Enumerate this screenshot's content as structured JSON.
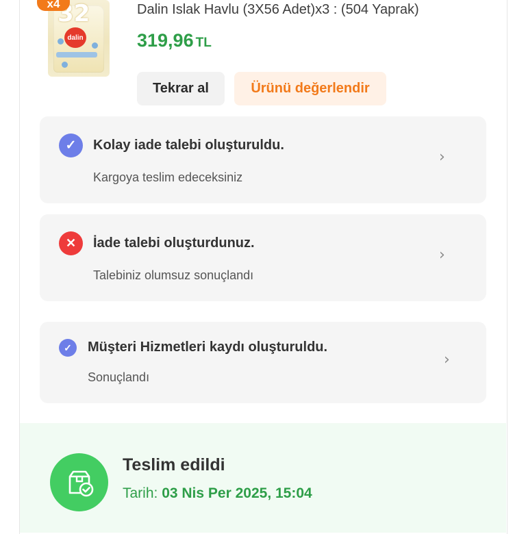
{
  "product": {
    "quantity_badge": "x4",
    "image_label": "dalin",
    "image_number": "32",
    "title": "Dalin Islak Havlu (3X56 Adet)x3 : (504 Yaprak)",
    "price": "319,96",
    "currency": "TL"
  },
  "actions": {
    "repeat_label": "Tekrar al",
    "rate_label": "Ürünü değerlendir"
  },
  "statuses": [
    {
      "icon": "check-icon",
      "title": "Kolay iade talebi oluşturuldu.",
      "subtitle": "Kargoya teslim edeceksiniz",
      "color": "#6d7ee8"
    },
    {
      "icon": "close-icon",
      "title": "İade talebi oluşturdunuz.",
      "subtitle": "Talebiniz olumsuz sonuçlandı",
      "color": "#ee3b3b"
    },
    {
      "icon": "check-icon",
      "title": "Müşteri Hizmetleri kaydı oluşturuldu.",
      "subtitle": "Sonuçlandı",
      "color": "#6d7ee8"
    }
  ],
  "delivery": {
    "icon": "delivered-box-icon",
    "title": "Teslim edildi",
    "date_label": "Tarih:",
    "date_value": "03 Nis Per 2025, 15:04"
  },
  "colors": {
    "price_green": "#2e9e48",
    "accent_orange": "#f27a1a",
    "success_green": "#43cd62"
  }
}
